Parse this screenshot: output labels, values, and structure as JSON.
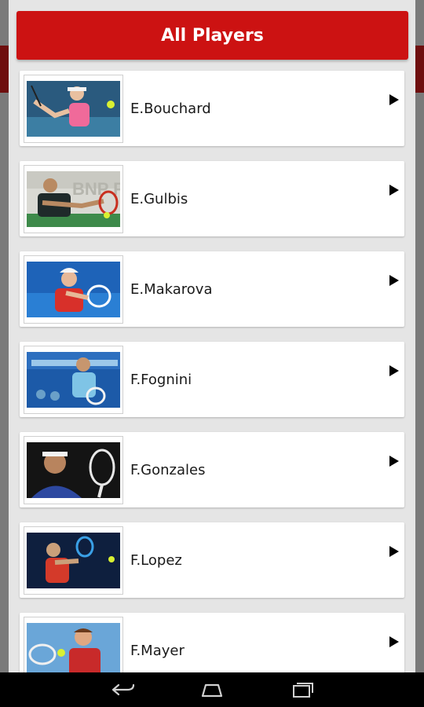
{
  "header": {
    "title": "All Players"
  },
  "players": [
    {
      "name": "E.Bouchard",
      "photo_icon": "tennis-player-photo"
    },
    {
      "name": "E.Gulbis",
      "photo_icon": "tennis-player-photo"
    },
    {
      "name": "E.Makarova",
      "photo_icon": "tennis-player-photo"
    },
    {
      "name": "F.Fognini",
      "photo_icon": "tennis-player-photo"
    },
    {
      "name": "F.Gonzales",
      "photo_icon": "tennis-player-photo"
    },
    {
      "name": "F.Lopez",
      "photo_icon": "tennis-player-photo"
    },
    {
      "name": "F.Mayer",
      "photo_icon": "tennis-player-photo"
    }
  ],
  "navbar": {
    "buttons": [
      "back-icon",
      "home-icon",
      "recents-icon"
    ]
  },
  "colors": {
    "accent": "#cc1212",
    "dialog_bg": "#e5e5e5",
    "row_bg": "#ffffff"
  }
}
